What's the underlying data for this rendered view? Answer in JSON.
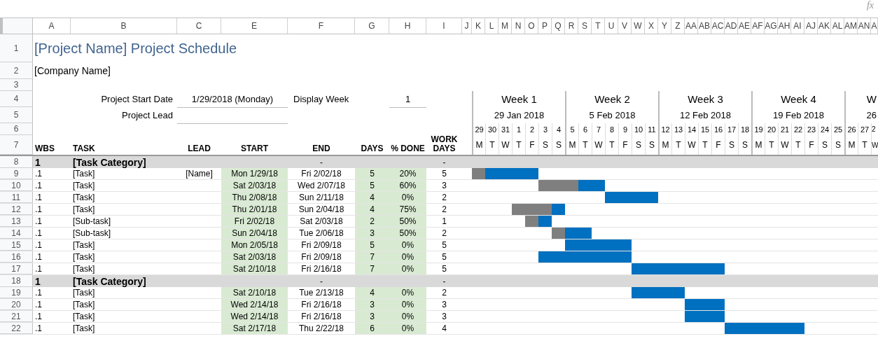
{
  "toolbar": {
    "formula_icon": "fx"
  },
  "column_letters": [
    "A",
    "B",
    "C",
    "E",
    "F",
    "G",
    "H",
    "I",
    "J",
    "K",
    "L",
    "M",
    "N",
    "O",
    "P",
    "Q",
    "R",
    "S",
    "T",
    "U",
    "V",
    "W",
    "X",
    "Y",
    "Z",
    "AA",
    "AB",
    "AC",
    "AD",
    "AE",
    "AF",
    "AG",
    "AH",
    "AI",
    "AJ",
    "AK",
    "AL",
    "AM",
    "AN",
    "A"
  ],
  "row_numbers": [
    "1",
    "2",
    "3",
    "4",
    "5",
    "6",
    "7",
    "8",
    "9",
    "10",
    "11",
    "12",
    "13",
    "14",
    "15",
    "16",
    "17",
    "18",
    "19",
    "20",
    "21",
    "22"
  ],
  "title": "[Project Name] Project Schedule",
  "company": "[Company Name]",
  "project_info": {
    "start_date_label": "Project Start Date",
    "start_date": "1/29/2018 (Monday)",
    "display_week_label": "Display Week",
    "display_week": "1",
    "lead_label": "Project Lead"
  },
  "weeks": [
    {
      "label": "Week 1",
      "date": "29 Jan 2018"
    },
    {
      "label": "Week 2",
      "date": "5 Feb 2018"
    },
    {
      "label": "Week 3",
      "date": "12 Feb 2018"
    },
    {
      "label": "Week 4",
      "date": "19 Feb 2018"
    },
    {
      "label": "W",
      "date": "26"
    }
  ],
  "days": [
    {
      "date": "29",
      "weekday": "M"
    },
    {
      "date": "30",
      "weekday": "T"
    },
    {
      "date": "31",
      "weekday": "W"
    },
    {
      "date": "1",
      "weekday": "T"
    },
    {
      "date": "2",
      "weekday": "F"
    },
    {
      "date": "3",
      "weekday": "S"
    },
    {
      "date": "4",
      "weekday": "S"
    },
    {
      "date": "5",
      "weekday": "M"
    },
    {
      "date": "6",
      "weekday": "T"
    },
    {
      "date": "7",
      "weekday": "W"
    },
    {
      "date": "8",
      "weekday": "T"
    },
    {
      "date": "9",
      "weekday": "F"
    },
    {
      "date": "10",
      "weekday": "S"
    },
    {
      "date": "11",
      "weekday": "S"
    },
    {
      "date": "12",
      "weekday": "M"
    },
    {
      "date": "13",
      "weekday": "T"
    },
    {
      "date": "14",
      "weekday": "W"
    },
    {
      "date": "15",
      "weekday": "T"
    },
    {
      "date": "16",
      "weekday": "F"
    },
    {
      "date": "17",
      "weekday": "S"
    },
    {
      "date": "18",
      "weekday": "S"
    },
    {
      "date": "19",
      "weekday": "M"
    },
    {
      "date": "20",
      "weekday": "T"
    },
    {
      "date": "21",
      "weekday": "W"
    },
    {
      "date": "22",
      "weekday": "T"
    },
    {
      "date": "23",
      "weekday": "F"
    },
    {
      "date": "24",
      "weekday": "S"
    },
    {
      "date": "25",
      "weekday": "S"
    },
    {
      "date": "26",
      "weekday": "M"
    },
    {
      "date": "27",
      "weekday": "T"
    },
    {
      "date": "2",
      "weekday": "W"
    }
  ],
  "table": {
    "columns": [
      "WBS",
      "TASK",
      "LEAD",
      "START",
      "END",
      "DAYS",
      "% DONE",
      "WORK DAYS"
    ],
    "rows": [
      {
        "kind": "category",
        "wbs": "1",
        "task": "[Task Category]",
        "end": "-",
        "work_days": "-"
      },
      {
        "kind": "task",
        "wbs": ".1",
        "task": "[Task]",
        "lead": "[Name]",
        "start": "Mon 1/29/18",
        "end": "Fri 2/02/18",
        "days": "5",
        "done": "20%",
        "work_days": "5",
        "scheduled": [
          true,
          true,
          true,
          true,
          true
        ],
        "completed": [
          true
        ]
      },
      {
        "kind": "task",
        "wbs": ".1",
        "task": "[Task]",
        "start": "Sat 2/03/18",
        "end": "Wed 2/07/18",
        "days": "5",
        "done": "60%",
        "work_days": "3",
        "scheduled": [
          false,
          false,
          false,
          false,
          false,
          true,
          true,
          true,
          true,
          true
        ],
        "completed": [
          false,
          false,
          false,
          false,
          false,
          true,
          true,
          true
        ]
      },
      {
        "kind": "task",
        "wbs": ".1",
        "task": "[Task]",
        "start": "Thu 2/08/18",
        "end": "Sun 2/11/18",
        "days": "4",
        "done": "0%",
        "work_days": "2",
        "scheduled": [
          false,
          false,
          false,
          false,
          false,
          false,
          false,
          false,
          false,
          false,
          true,
          true,
          true,
          true
        ]
      },
      {
        "kind": "task",
        "wbs": ".1",
        "task": "[Task]",
        "start": "Thu 2/01/18",
        "end": "Sun 2/04/18",
        "days": "4",
        "done": "75%",
        "work_days": "2",
        "scheduled": [
          false,
          false,
          false,
          true,
          true,
          true,
          true
        ],
        "completed": [
          false,
          false,
          false,
          true,
          true,
          true
        ]
      },
      {
        "kind": "task",
        "wbs": ".1",
        "task": "[Sub-task]",
        "start": "Fri 2/02/18",
        "end": "Sat 2/03/18",
        "days": "2",
        "done": "50%",
        "work_days": "1",
        "scheduled": [
          false,
          false,
          false,
          false,
          true,
          true
        ],
        "completed": [
          false,
          false,
          false,
          false,
          true
        ]
      },
      {
        "kind": "task",
        "wbs": ".1",
        "task": "[Sub-task]",
        "start": "Sun 2/04/18",
        "end": "Tue 2/06/18",
        "days": "3",
        "done": "50%",
        "work_days": "2",
        "scheduled": [
          false,
          false,
          false,
          false,
          false,
          false,
          true,
          true,
          true
        ],
        "completed": [
          false,
          false,
          false,
          false,
          false,
          false,
          true
        ]
      },
      {
        "kind": "task",
        "wbs": ".1",
        "task": "[Task]",
        "start": "Mon 2/05/18",
        "end": "Fri 2/09/18",
        "days": "5",
        "done": "0%",
        "work_days": "5",
        "scheduled": [
          false,
          false,
          false,
          false,
          false,
          false,
          false,
          true,
          true,
          true,
          true,
          true
        ]
      },
      {
        "kind": "task",
        "wbs": ".1",
        "task": "[Task]",
        "start": "Sat 2/03/18",
        "end": "Fri 2/09/18",
        "days": "7",
        "done": "0%",
        "work_days": "5",
        "scheduled": [
          false,
          false,
          false,
          false,
          false,
          true,
          true,
          true,
          true,
          true,
          true,
          true
        ]
      },
      {
        "kind": "task",
        "wbs": ".1",
        "task": "[Task]",
        "start": "Sat 2/10/18",
        "end": "Fri 2/16/18",
        "days": "7",
        "done": "0%",
        "work_days": "5",
        "scheduled": [
          false,
          false,
          false,
          false,
          false,
          false,
          false,
          false,
          false,
          false,
          false,
          false,
          true,
          true,
          true,
          true,
          true,
          true,
          true
        ]
      },
      {
        "kind": "category",
        "wbs": "1",
        "task": "[Task Category]",
        "end": "-",
        "work_days": "-"
      },
      {
        "kind": "task",
        "wbs": ".1",
        "task": "[Task]",
        "start": "Sat 2/10/18",
        "end": "Tue 2/13/18",
        "days": "4",
        "done": "0%",
        "work_days": "2",
        "scheduled": [
          false,
          false,
          false,
          false,
          false,
          false,
          false,
          false,
          false,
          false,
          false,
          false,
          true,
          true,
          true,
          true
        ]
      },
      {
        "kind": "task",
        "wbs": ".1",
        "task": "[Task]",
        "start": "Wed 2/14/18",
        "end": "Fri 2/16/18",
        "days": "3",
        "done": "0%",
        "work_days": "3",
        "scheduled": [
          false,
          false,
          false,
          false,
          false,
          false,
          false,
          false,
          false,
          false,
          false,
          false,
          false,
          false,
          false,
          false,
          true,
          true,
          true
        ]
      },
      {
        "kind": "task",
        "wbs": ".1",
        "task": "[Task]",
        "start": "Wed 2/14/18",
        "end": "Fri 2/16/18",
        "days": "3",
        "done": "0%",
        "work_days": "3",
        "scheduled": [
          false,
          false,
          false,
          false,
          false,
          false,
          false,
          false,
          false,
          false,
          false,
          false,
          false,
          false,
          false,
          false,
          true,
          true,
          true
        ]
      },
      {
        "kind": "task",
        "wbs": ".1",
        "task": "[Task]",
        "start": "Sat 2/17/18",
        "end": "Thu 2/22/18",
        "days": "6",
        "done": "0%",
        "work_days": "4",
        "scheduled": [
          false,
          false,
          false,
          false,
          false,
          false,
          false,
          false,
          false,
          false,
          false,
          false,
          false,
          false,
          false,
          false,
          false,
          false,
          false,
          true,
          true,
          true,
          true,
          true,
          true
        ]
      }
    ]
  }
}
